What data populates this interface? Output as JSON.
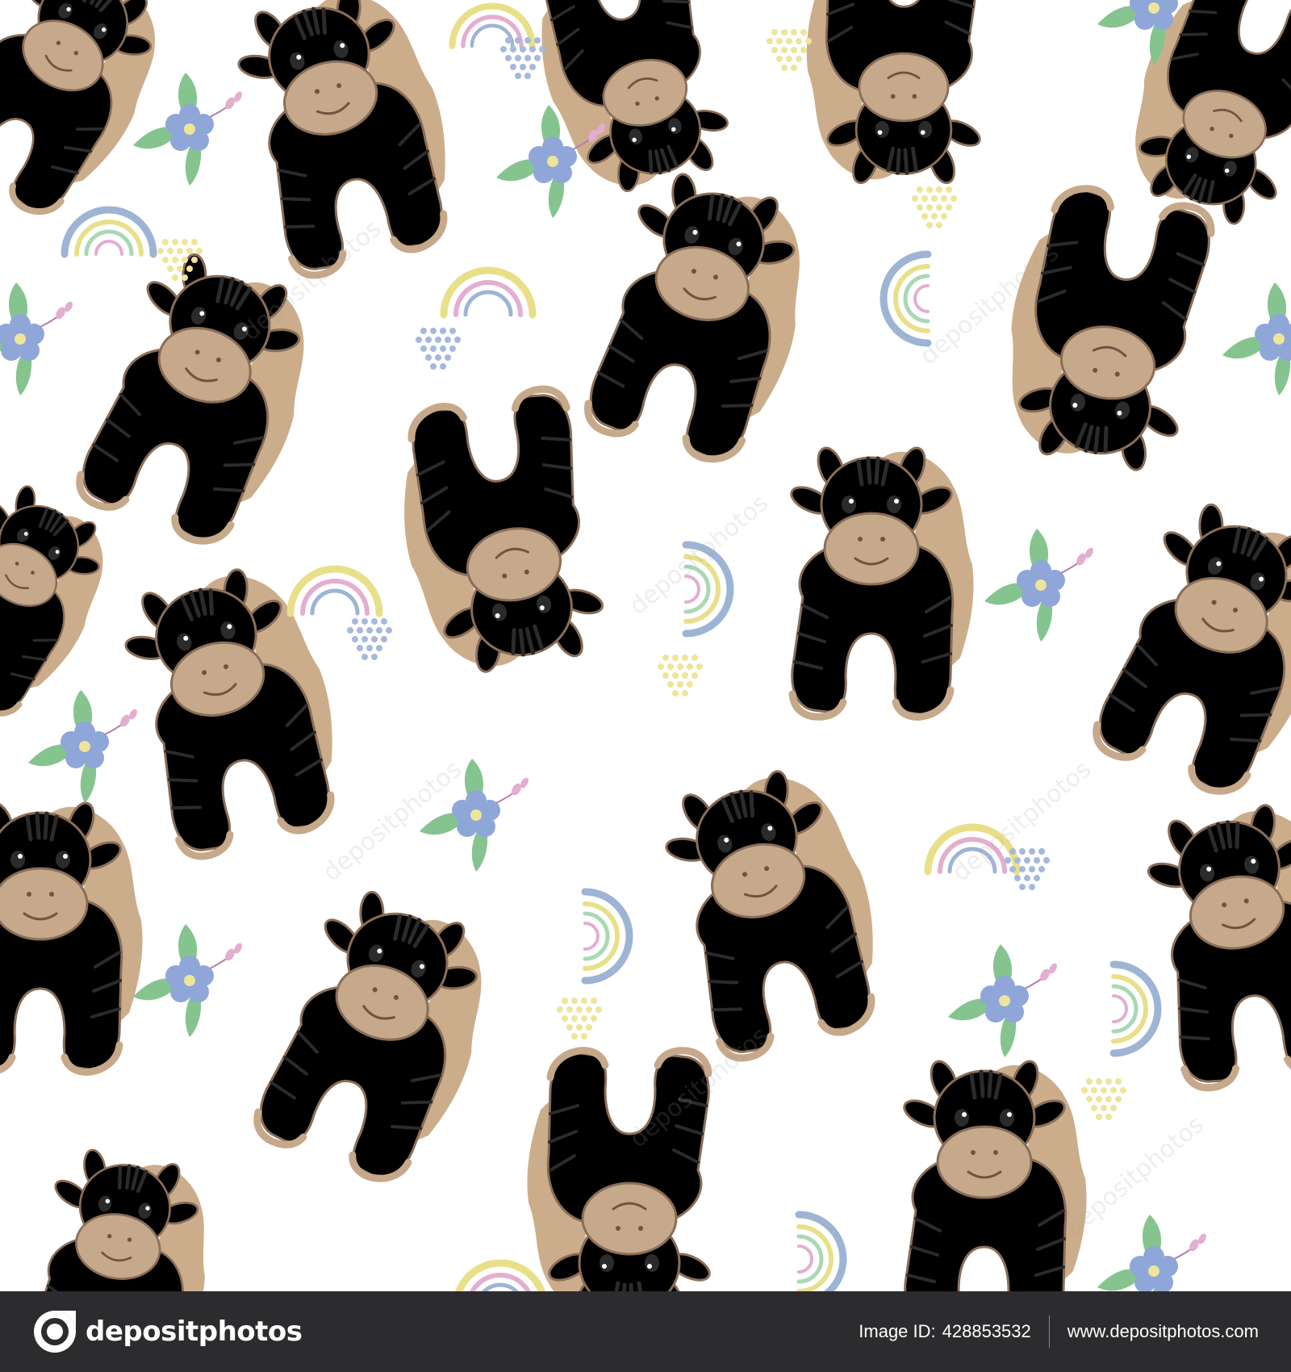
{
  "footer": {
    "brand": "depositphotos",
    "image_id_label": "Image ID:",
    "image_id": "428853532",
    "website": "www.depositphotos.com"
  },
  "watermark": "depositphotos",
  "colors": {
    "pink_body": "#f9d8ec",
    "blue_body": "#c8cdf4",
    "muzzle": "#c6a88a",
    "mane": "#c9a985",
    "outline": "#8a6e58",
    "stripe": "#2b2b2b",
    "rainbow_blue": "#9eb4d4",
    "rainbow_yellow": "#e8e089",
    "rainbow_green": "#a9d8b5",
    "rainbow_pink": "#e3aed0",
    "flower_blue": "#8fa6d8",
    "leaf_green": "#86c48f",
    "dots_yellow": "#eee59a",
    "dots_blue": "#a6b8dc",
    "footer_bg": "#2c2c2e"
  }
}
